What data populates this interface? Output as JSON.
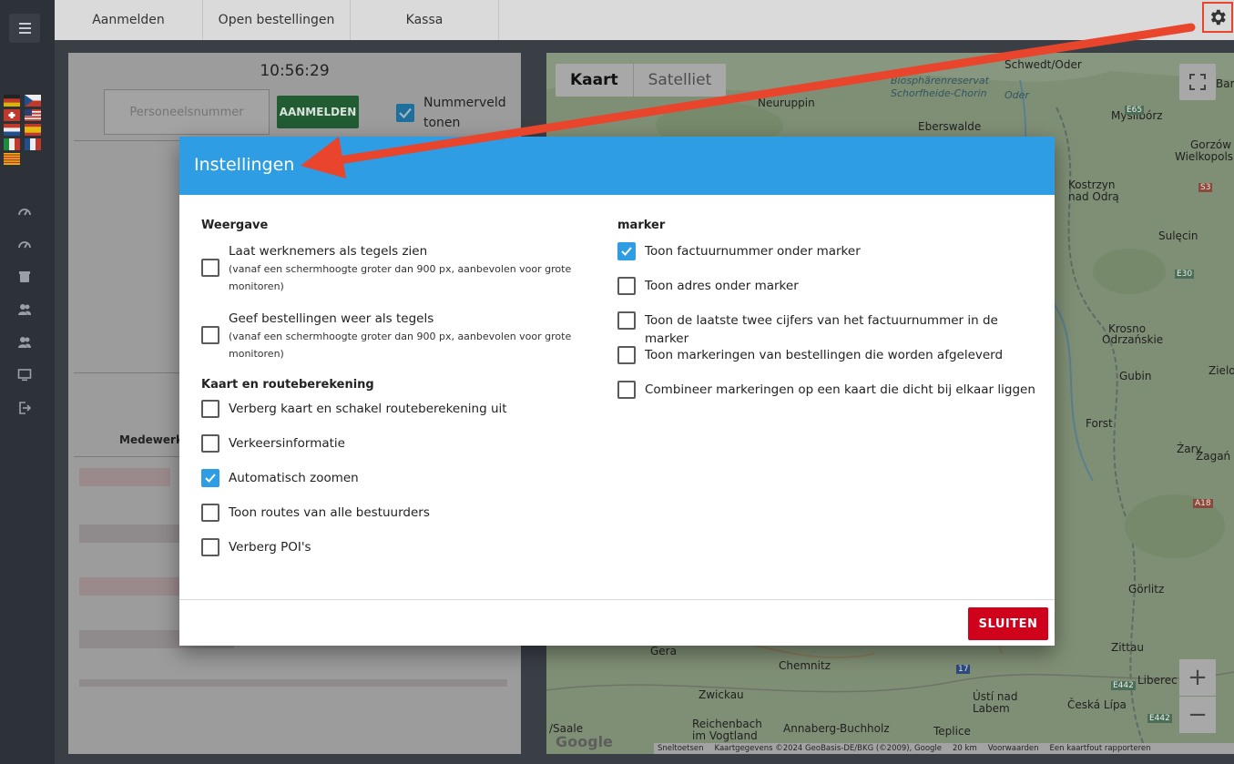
{
  "top_tabs": [
    "Aanmelden",
    "Open bestellingen",
    "Kassa"
  ],
  "left_panel": {
    "clock": "10:56:29",
    "personnel_placeholder": "Personeelsnummer",
    "login_button": "AANMELDEN",
    "show_number_field_label": "Nummerveld tonen",
    "employees_header": "Medewerker"
  },
  "map": {
    "type_map": "Kaart",
    "type_satellite": "Satelliet",
    "zoom_in": "+",
    "zoom_out": "−",
    "google": "Google",
    "attribution": {
      "shortcuts": "Sneltoetsen",
      "data": "Kaartgegevens ©2024 GeoBasis-DE/BKG (©2009), Google",
      "scale": "20 km",
      "terms": "Voorwaarden",
      "report": "Een kaartfout rapporteren"
    },
    "labels": {
      "schwedt": "Schwedt/Oder",
      "biosphaere": "Biosphärenreservat",
      "schorfheide": "Schorfheide-Chorin",
      "oder": "Oder",
      "neuruppin": "Neuruppin",
      "eberswalde": "Eberswalde",
      "mysliborz": "Myślibórz",
      "bar": "Bar",
      "gorzow": "Gorzów",
      "wielkopolski": "Wielkopolski",
      "kostrzyn": "Kostrzyn",
      "nad_odra": "nad Odrą",
      "sulecin": "Sulęcin",
      "krosno": "Krosno",
      "odrzanskie": "Odrzańskie",
      "gubin": "Gubin",
      "zielo": "Zielo",
      "forst": "Forst",
      "zary": "Żary",
      "zagan": "Żagań",
      "gorlitz": "Görlitz",
      "zittau": "Zittau",
      "liberec": "Liberec",
      "gera": "Gera",
      "chemnitz": "Chemnitz",
      "zwickau": "Zwickau",
      "usti": "Ústí nad",
      "labem": "Labem",
      "ceska_lipa": "Česká Lípa",
      "reichenbach": "Reichenbach",
      "vogtland": "im Vogtland",
      "annaberg": "Annaberg-Buchholz",
      "saale": "/Saale",
      "teplice": "Teplice",
      "road_e65": "E65",
      "road_s3": "S3",
      "road_e30": "E30",
      "road_a18": "A18",
      "road_e442a": "E442",
      "road_e442b": "E442",
      "road_17": "17"
    }
  },
  "modal": {
    "title": "Instellingen",
    "left_sections": [
      {
        "title": "Weergave",
        "options": [
          {
            "label": "Laat werknemers als tegels zien",
            "sub": "(vanaf een schermhoogte groter dan 900 px, aanbevolen voor grote monitoren)",
            "checked": false
          },
          {
            "label": "Geef bestellingen weer als tegels",
            "sub": "(vanaf een schermhoogte groter dan 900 px, aanbevolen voor grote monitoren)",
            "checked": false
          }
        ]
      },
      {
        "title": "Kaart en routeberekening",
        "options": [
          {
            "label": "Verberg kaart en schakel routeberekening uit",
            "checked": false
          },
          {
            "label": "Verkeersinformatie",
            "checked": false
          },
          {
            "label": "Automatisch zoomen",
            "checked": true
          },
          {
            "label": "Toon routes van alle bestuurders",
            "checked": false
          },
          {
            "label": "Verberg POI's",
            "checked": false
          }
        ]
      }
    ],
    "right_section": {
      "title": "marker",
      "options": [
        {
          "label": "Toon factuurnummer onder marker",
          "checked": true
        },
        {
          "label": "Toon adres onder marker",
          "checked": false
        },
        {
          "label": "Toon de laatste twee cijfers van het factuurnummer in de marker",
          "checked": false
        },
        {
          "label": "Toon markeringen van bestellingen die worden afgeleverd",
          "checked": false
        },
        {
          "label": "Combineer markeringen op een kaart die dicht bij elkaar liggen",
          "checked": false
        }
      ]
    },
    "close_button": "SLUITEN"
  },
  "colors": {
    "accent": "#2e9de4",
    "close_button": "#d0021b",
    "arrow": "#e8452c"
  }
}
